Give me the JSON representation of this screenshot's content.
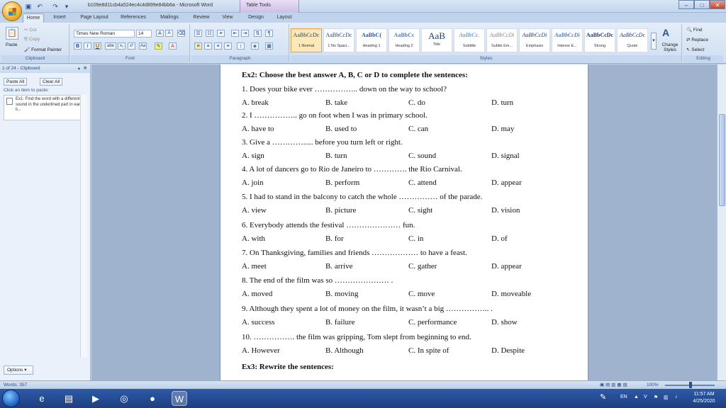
{
  "window": {
    "title": "b109e8d11cb4a524ec4c4d899e84bb6a - Microsoft Word",
    "context_tab_title": "Table Tools"
  },
  "tabs": [
    "Home",
    "Insert",
    "Page Layout",
    "References",
    "Mailings",
    "Review",
    "View",
    "Design",
    "Layout"
  ],
  "ribbon": {
    "clipboard": {
      "label": "Clipboard",
      "paste": "Paste",
      "cut": "Cut",
      "copy": "Copy",
      "format_painter": "Format Painter"
    },
    "font": {
      "label": "Font",
      "font_name": "Times New Roman",
      "font_size": "14"
    },
    "paragraph": {
      "label": "Paragraph"
    },
    "styles": {
      "label": "Styles",
      "items": [
        {
          "sample": "AaBbCcDc",
          "name": "1 Normal"
        },
        {
          "sample": "AaBbCcDc",
          "name": "1 No Spaci..."
        },
        {
          "sample": "AaBbC(",
          "name": "Heading 1"
        },
        {
          "sample": "AaBbCc",
          "name": "Heading 2"
        },
        {
          "sample": "AaB",
          "name": "Title"
        },
        {
          "sample": "AaBbCc.",
          "name": "Subtitle"
        },
        {
          "sample": "AaBbCcDi",
          "name": "Subtle Em..."
        },
        {
          "sample": "AaBbCcDi",
          "name": "Emphasis"
        },
        {
          "sample": "AaBbCcDi",
          "name": "Intense E..."
        },
        {
          "sample": "AaBbCcDc",
          "name": "Strong"
        },
        {
          "sample": "AaBbCcDc",
          "name": "Quote"
        }
      ],
      "change_styles": "Change Styles"
    },
    "editing": {
      "label": "Editing",
      "find": "Find",
      "replace": "Replace",
      "select": "Select"
    }
  },
  "clipboard_pane": {
    "header": "1 of 24 - Clipboard",
    "paste_all": "Paste All",
    "clear_all": "Clear All",
    "hint": "Click an item to paste:",
    "item_text": "Ex1: Find the word with a different sound in the underlined part in each li...",
    "options": "Options"
  },
  "document": {
    "heading": "Ex2: Choose the best answer A, B, C or D to complete the sentences:",
    "questions": [
      {
        "q": "1. Does your bike ever …………….. down on the way to school?",
        "a": "A. break",
        "b": "B. take",
        "c": "C. do",
        "d": "D. turn"
      },
      {
        "q": "2. I …………….. go on foot when I was in primary school.",
        "a": "A. have to",
        "b": "B. used to",
        "c": "C. can",
        "d": "D. may"
      },
      {
        "q": "3. Give a …………..... before you turn left or right.",
        "a": "A. sign",
        "b": "B. turn",
        "c": "C. sound",
        "d": "D. signal"
      },
      {
        "q": "4. A lot of dancers go to Rio de Janeiro to …………. the Rio Carnival.",
        "a": "A. join",
        "b": "B. perform",
        "c": "C. attend",
        "d": "D. appear"
      },
      {
        "q": "5. I had to stand in the balcony to catch the whole …………… of the parade.",
        "a": "A. view",
        "b": "B. picture",
        "c": "C. sight",
        "d": "D. vision"
      },
      {
        "q": "6. Everybody attends the festival ………………… fun.",
        "a": "A. with",
        "b": "B. for",
        "c": "C. in",
        "d": "D. of"
      },
      {
        "q": "7. On Thanksgiving, families and friends ……………… to have a feast.",
        "a": "A. meet",
        "b": "B. arrive",
        "c": "C. gather",
        "d": "D. appear"
      },
      {
        "q": "8. The end of the film was so ………………… .",
        "a": "A. moved",
        "b": "B. moving",
        "c": "C. move",
        "d": "D. moveable"
      },
      {
        "q": "9. Although they spent a lot of money on the film, it wasn’t a big …………….. .",
        "a": "A. success",
        "b": "B. failure",
        "c": "C. performance",
        "d": "D. show"
      },
      {
        "q": "10. ……………. the film was gripping, Tom slept from beginning to end.",
        "a": "A. However",
        "b": "B. Although",
        "c": "C. In spite of",
        "d": "D. Despite"
      }
    ],
    "next_heading": "Ex3: Rewrite the sentences:"
  },
  "status": {
    "words": "Words: 357",
    "zoom": "100%"
  },
  "taskbar": {
    "language": "EN",
    "time": "11:57 AM",
    "date": "4/25/2020"
  }
}
